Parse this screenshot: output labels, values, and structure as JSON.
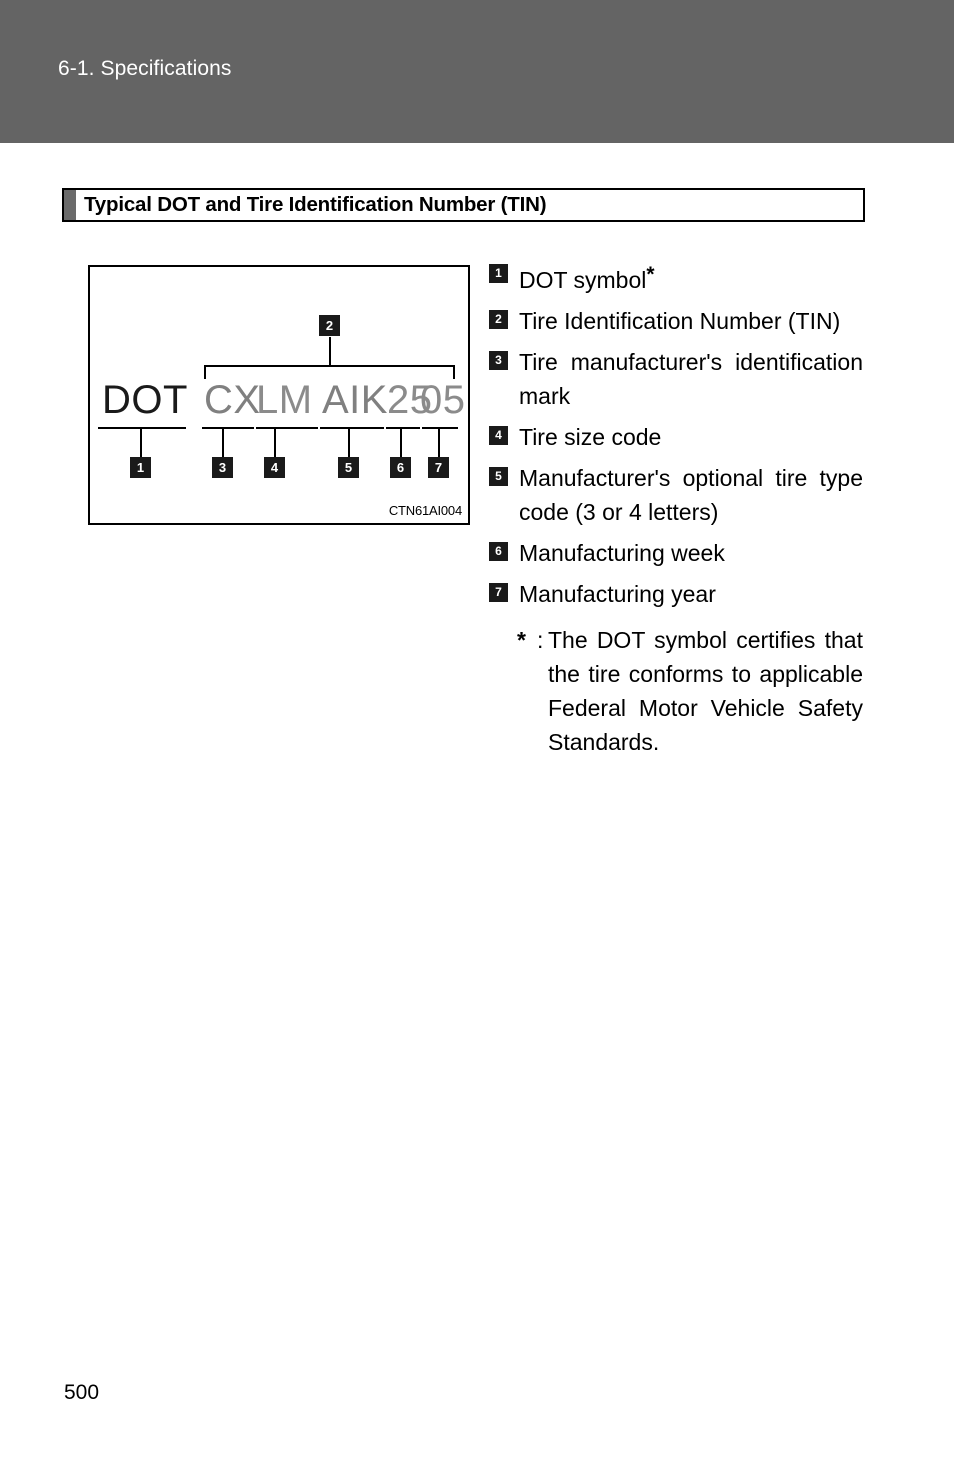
{
  "page": {
    "running_header": "6-1. Specifications",
    "page_number": "500"
  },
  "section": {
    "title": "Typical DOT and Tire Identification Number (TIN)"
  },
  "figure": {
    "code": "CTN61AI004",
    "tin_segments": [
      {
        "text": "DOT",
        "callout": "1",
        "color": "#1a1a1a"
      },
      {
        "text": "CX",
        "callout": "3",
        "color": "#808080"
      },
      {
        "text": "LM",
        "callout": "4",
        "color": "#8b8b8b"
      },
      {
        "text": "AIK",
        "callout": "5",
        "color": "#808080"
      },
      {
        "text": "25",
        "callout": "6",
        "color": "#8b8b8b"
      },
      {
        "text": "05",
        "callout": "7",
        "color": "#8b8b8b"
      }
    ],
    "bracket_callout": "2",
    "badges": {
      "b1": "1",
      "b2": "2",
      "b3": "3",
      "b4": "4",
      "b5": "5",
      "b6": "6",
      "b7": "7"
    }
  },
  "legend": {
    "items": [
      {
        "num": "1",
        "text": "DOT symbol",
        "suffix": "*"
      },
      {
        "num": "2",
        "text": "Tire Identification Number (TIN)"
      },
      {
        "num": "3",
        "text": "Tire manufacturer's identification mark"
      },
      {
        "num": "4",
        "text": "Tire size code"
      },
      {
        "num": "5",
        "text": "Manufacturer's optional tire type code (3 or 4 letters)"
      },
      {
        "num": "6",
        "text": "Manufacturing week"
      },
      {
        "num": "7",
        "text": "Manufacturing year"
      }
    ],
    "footnote": {
      "marker": "*",
      "colon": ":",
      "text": "The DOT symbol certifies that the tire conforms to applicable Federal Motor Vehicle Safety Standards."
    }
  }
}
